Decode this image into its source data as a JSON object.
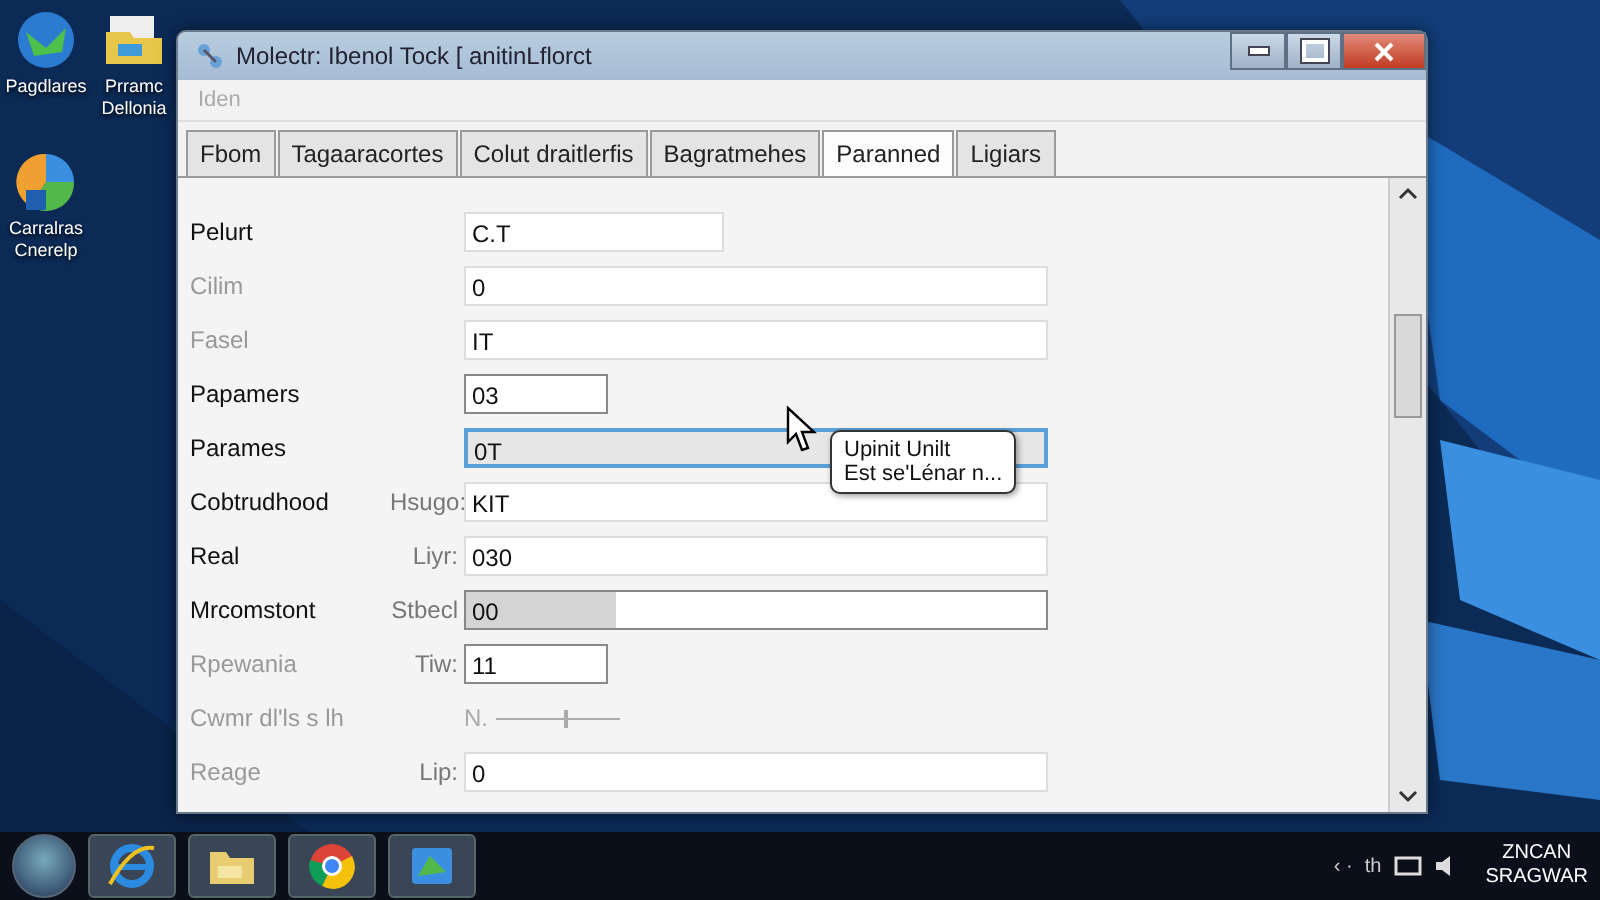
{
  "desktop_icons": [
    {
      "label": "Pagdlares",
      "kind": "globe"
    },
    {
      "label": "Prramc Dellonia",
      "kind": "folder"
    },
    {
      "label": "Carralras Cnerelp",
      "kind": "pie"
    }
  ],
  "window": {
    "title": "Molectr: Ibenol Tock [ anitinLflorct",
    "menu": [
      "Iden"
    ]
  },
  "tabs": [
    {
      "label": "Fbom",
      "selected": false
    },
    {
      "label": "Tagaaracortes",
      "selected": false
    },
    {
      "label": "Colut draitlerfis",
      "selected": false
    },
    {
      "label": "Bagratmehes",
      "selected": false
    },
    {
      "label": "Paranned",
      "selected": true
    },
    {
      "label": "Ligiars",
      "selected": false
    }
  ],
  "rows": [
    {
      "label": "Pelurt",
      "value": "C.T",
      "kind": "short-field",
      "disabled": false,
      "focused": false
    },
    {
      "label": "Cilim",
      "value": "0",
      "kind": "field",
      "disabled": true,
      "focused": false
    },
    {
      "label": "Fasel",
      "value": "IT",
      "kind": "field",
      "disabled": true,
      "focused": false
    },
    {
      "label": "Papamers",
      "value": "03",
      "kind": "tiny-field",
      "disabled": false,
      "focused": false
    },
    {
      "label": "Parames",
      "value": "0T",
      "kind": "field",
      "disabled": false,
      "focused": true
    },
    {
      "label": "Cobtrudhood",
      "sublabel": "Hsugo:",
      "value": "KIT",
      "kind": "field",
      "disabled": false,
      "focused": false
    },
    {
      "label": "Real",
      "sublabel": "Liyr:",
      "value": "030",
      "kind": "field",
      "disabled": false,
      "focused": false
    },
    {
      "label": "Mrcomstont",
      "sublabel": "Stbecl",
      "value": "00",
      "kind": "meter",
      "level": 0.26,
      "disabled": false,
      "focused": false
    },
    {
      "label": "Rpewania",
      "sublabel": "Tiw:",
      "value": "11",
      "kind": "tiny-field",
      "disabled": true,
      "focused": false
    },
    {
      "label": "Cwmr dl'ls s lh",
      "value": "N.",
      "kind": "slider",
      "level": 0.55,
      "disabled": true,
      "focused": false
    },
    {
      "label": "Reage",
      "sublabel": "Lip:",
      "value": "0",
      "kind": "field",
      "disabled": true,
      "focused": false
    }
  ],
  "tooltip": {
    "lines": [
      "Upinit Unilt",
      "Est se'Lénar n..."
    ]
  },
  "taskbar": {
    "apps": [
      {
        "kind": "ie"
      },
      {
        "kind": "folder"
      },
      {
        "kind": "chrome"
      },
      {
        "kind": "tool"
      }
    ],
    "tray": [
      "‹ ·",
      "th"
    ],
    "clock": [
      "ZNCAN",
      "SRAGWAR"
    ]
  }
}
